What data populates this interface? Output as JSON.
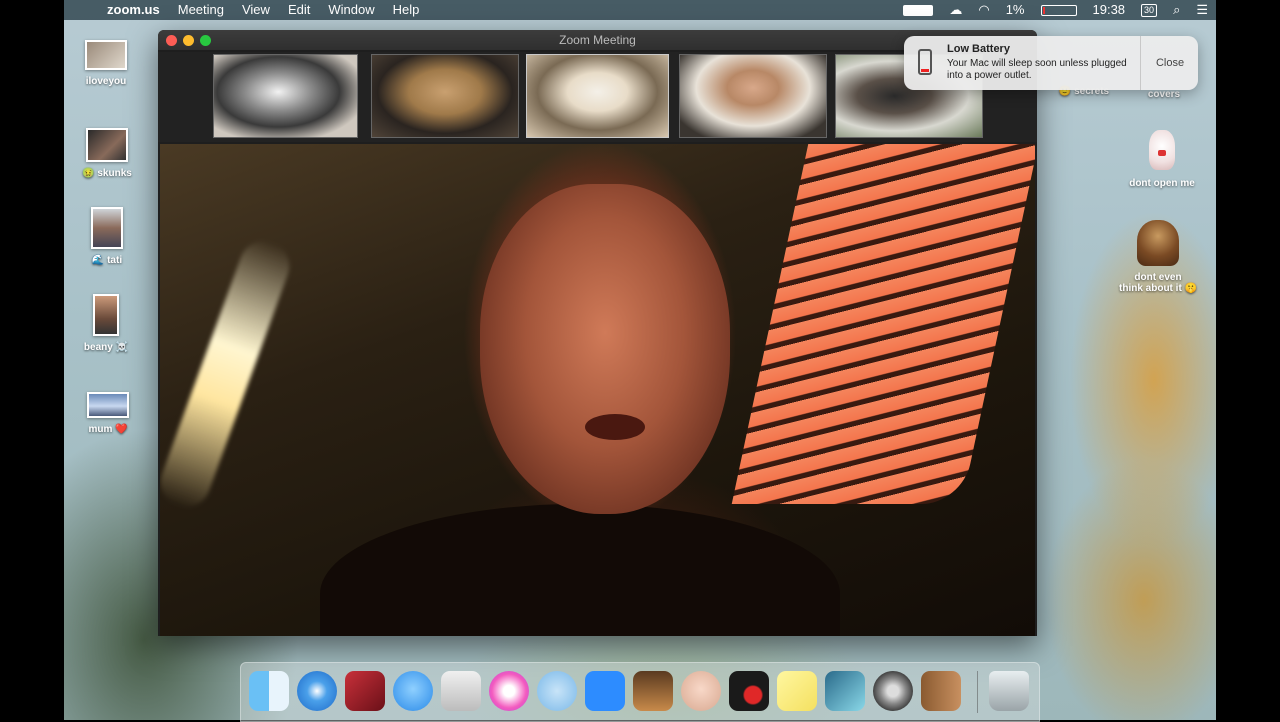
{
  "menubar": {
    "app_name": "zoom.us",
    "menus": [
      "Meeting",
      "View",
      "Edit",
      "Window",
      "Help"
    ],
    "battery_percent": "1%",
    "clock": "19:38",
    "calendar_day": "30"
  },
  "desktop_left": [
    {
      "label": "iloveyou"
    },
    {
      "label": "🤢 skunks"
    },
    {
      "label": "🌊 tati"
    },
    {
      "label": "beany ☠️"
    },
    {
      "label": "mum ❤️"
    }
  ],
  "desktop_right": [
    {
      "label": "🙂 secrets"
    },
    {
      "label": "covers"
    },
    {
      "label": "dont open me"
    },
    {
      "label_line1": "dont even",
      "label_line2": "think about it 🤫"
    }
  ],
  "zoom_window": {
    "title": "Zoom Meeting",
    "participants": [
      "husky",
      "doodle",
      "jack-russell",
      "woman",
      "shih-tzu"
    ]
  },
  "notification": {
    "title": "Low Battery",
    "body": "Your Mac will sleep soon unless plugged into a power outlet.",
    "close_label": "Close"
  },
  "dock": {
    "apps": [
      "finder",
      "safari",
      "photo-booth",
      "messages",
      "inkscape",
      "itunes",
      "seal",
      "zoom",
      "garageband",
      "face",
      "dvd-player",
      "stickies",
      "preview",
      "system-preferences",
      "contacts",
      "trash"
    ]
  }
}
